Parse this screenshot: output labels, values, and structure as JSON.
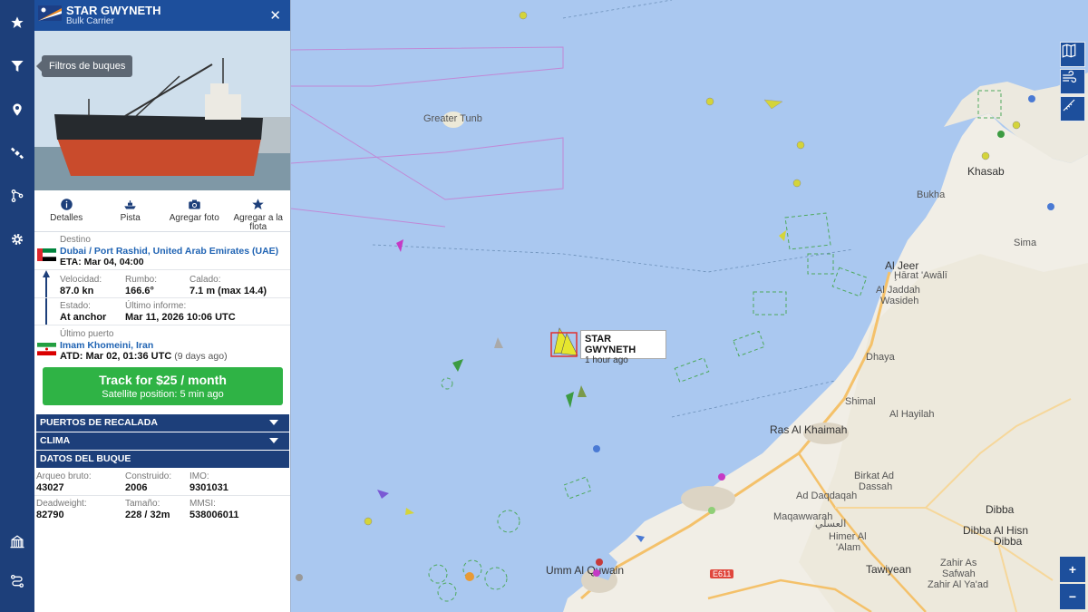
{
  "rail": {
    "items": [
      {
        "name": "favorites",
        "icon": "star-icon"
      },
      {
        "name": "filters",
        "icon": "filter-icon"
      },
      {
        "name": "location",
        "icon": "map-pin-icon"
      },
      {
        "name": "satellite",
        "icon": "satellite-icon"
      },
      {
        "name": "routes",
        "icon": "route-icon"
      },
      {
        "name": "settings",
        "icon": "gear-icon"
      },
      {
        "name": "ports",
        "icon": "port-icon"
      },
      {
        "name": "tracks",
        "icon": "track-path-icon"
      }
    ],
    "tooltip": "Filtros de buques"
  },
  "vessel": {
    "name": "STAR GWYNETH",
    "type": "Bulk Carrier"
  },
  "actions": [
    {
      "label": "Detalles",
      "icon": "info-icon"
    },
    {
      "label": "Pista",
      "icon": "ship-icon"
    },
    {
      "label": "Agregar foto",
      "icon": "camera-icon"
    },
    {
      "label": "Agregar a la flota",
      "icon": "star-icon"
    }
  ],
  "voyage": {
    "destination_label": "Destino",
    "destination": "Dubai / Port Rashid, United Arab Emirates (UAE)",
    "eta": "ETA: Mar 04, 04:00",
    "speed_label": "Velocidad:",
    "speed": "87.0 kn",
    "course_label": "Rumbo:",
    "course": "166.6°",
    "draught_label": "Calado:",
    "draught": "7.1 m (max 14.4)",
    "status_label": "Estado:",
    "status": "At anchor",
    "last_report_label": "Último informe:",
    "last_report": "Mar 11, 2026 10:06 UTC",
    "last_port_label": "Último puerto",
    "last_port": "Imam Khomeini, Iran",
    "atd": "ATD: Mar 02, 01:36 UTC",
    "atd_ago": "(9 days ago)"
  },
  "track_button": {
    "title": "Track for $25 / month",
    "subtitle": "Satellite position: 5 min ago"
  },
  "accordions": {
    "ports": "PUERTOS DE RECALADA",
    "weather": "CLIMA",
    "vessel_data": "DATOS DEL BUQUE"
  },
  "vessel_data": {
    "gt_label": "Arqueo bruto:",
    "gt": "43027",
    "built_label": "Construido:",
    "built": "2006",
    "imo_label": "IMO:",
    "imo": "9301031",
    "dwt_label": "Deadweight:",
    "dwt": "82790",
    "size_label": "Tamaño:",
    "size": "228 / 32m",
    "mmsi_label": "MMSI:",
    "mmsi": "538006011"
  },
  "map": {
    "tooltip_name": "STAR GWYNETH",
    "tooltip_age": "1 hour ago",
    "labels": {
      "greater_tunb": "Greater Tunb",
      "khasab": "Khasab",
      "bukha": "Bukha",
      "sima": "Sima",
      "al_jeer": "Al Jeer",
      "harat_awali": "Ḩārat 'Awālī",
      "al_jaddah": "Al Jaddah",
      "wasideh": "Wasideh",
      "dhaya": "Dhaya",
      "shimal": "Shimal",
      "al_hayilah": "Al Hayilah",
      "ras_al_khaimah": "Ras Al Khaimah",
      "birkat_ad_dassah_1": "Birkat Ad",
      "birkat_ad_dassah_2": "Dassah",
      "ad_daqdaqah": "Ad Daqdaqah",
      "dibba": "Dibba",
      "maqawwarah": "Maqawwarah",
      "arabic": "العسلي",
      "himer_al_alam_1": "Himer Al",
      "himer_al_alam_2": "'Alam",
      "dibba_al_hisn_1": "Dibba Al Hisn",
      "dibba_al_hisn_2": "Dibba",
      "umm_al_quwain": "Umm Al Quwain",
      "tawiyean": "Tawiyean",
      "zahir_as_1": "Zahir As",
      "zahir_as_2": "Safwah",
      "zahir_as_3": "Zahir Al Ya'ad",
      "road": "E611"
    },
    "controls": [
      "map-layers-icon",
      "wind-icon",
      "measure-icon"
    ],
    "zoom_in": "+",
    "zoom_out": "−"
  }
}
